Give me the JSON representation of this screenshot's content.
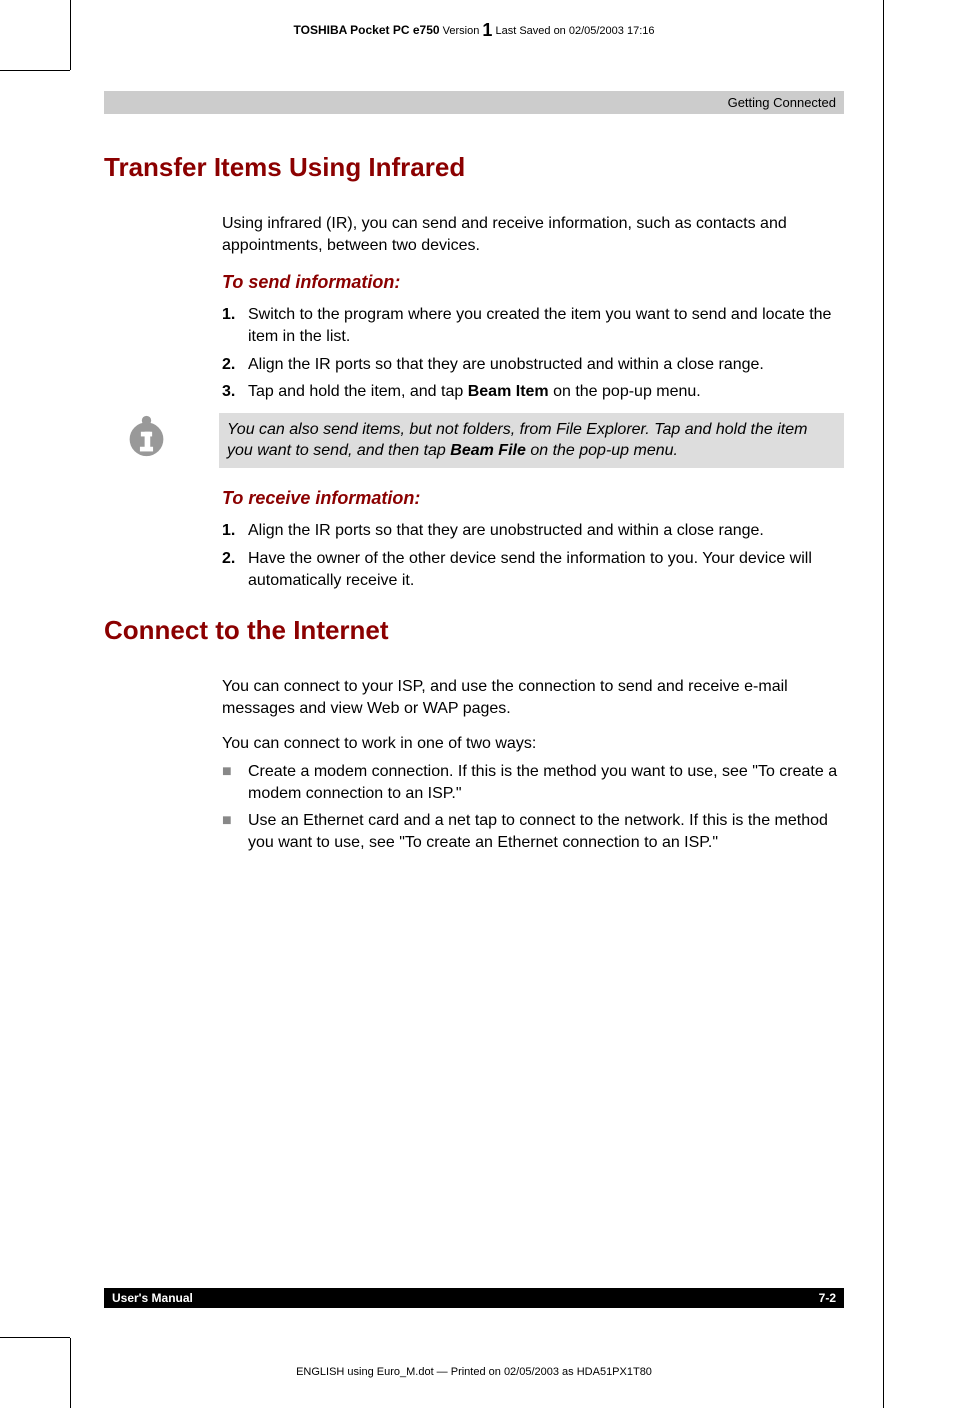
{
  "header": {
    "brand_model": "TOSHIBA Pocket PC e750",
    "version_label": "Version",
    "version_num": "1",
    "saved": "Last Saved on 02/05/2003 17:16"
  },
  "banner": "Getting Connected",
  "sections": {
    "infrared": {
      "title": "Transfer Items Using Infrared",
      "intro": "Using infrared (IR), you can send and receive information, such as contacts and appointments, between two devices.",
      "send": {
        "heading": "To send information:",
        "steps": [
          {
            "n": "1.",
            "text": "Switch to the program where you created the item you want to send and locate the item in the list."
          },
          {
            "n": "2.",
            "text": "Align the IR ports so that they are unobstructed and within a close range."
          },
          {
            "n": "3.",
            "prefix": "Tap and hold the item, and tap ",
            "bold": "Beam Item",
            "suffix": " on the pop-up menu."
          }
        ],
        "note_prefix": "You can also send items, but not folders, from File Explorer. Tap and hold the item you want to send, and then tap ",
        "note_bold": "Beam File",
        "note_suffix": " on the pop-up menu."
      },
      "receive": {
        "heading": "To receive information:",
        "steps": [
          {
            "n": "1.",
            "text": "Align the IR ports so that they are unobstructed and within a close range."
          },
          {
            "n": "2.",
            "text": "Have the owner of the other device send the information to you. Your device will automatically receive it."
          }
        ]
      }
    },
    "internet": {
      "title": "Connect to the Internet",
      "p1": "You can connect to your ISP, and use the connection to send and receive e-mail messages and view Web or WAP pages.",
      "p2": "You can connect to work in one of two ways:",
      "bullets": [
        "Create a modem connection. If this is the method you want to use, see \"To create a modem connection to an ISP.\"",
        "Use an Ethernet card and a net tap to connect to the network. If this is the method you want to use, see \"To create an Ethernet connection to an ISP.\""
      ]
    }
  },
  "footer": {
    "left": "User's Manual",
    "right": "7-2",
    "print": "ENGLISH using Euro_M.dot — Printed on 02/05/2003 as HDA51PX1T80"
  }
}
